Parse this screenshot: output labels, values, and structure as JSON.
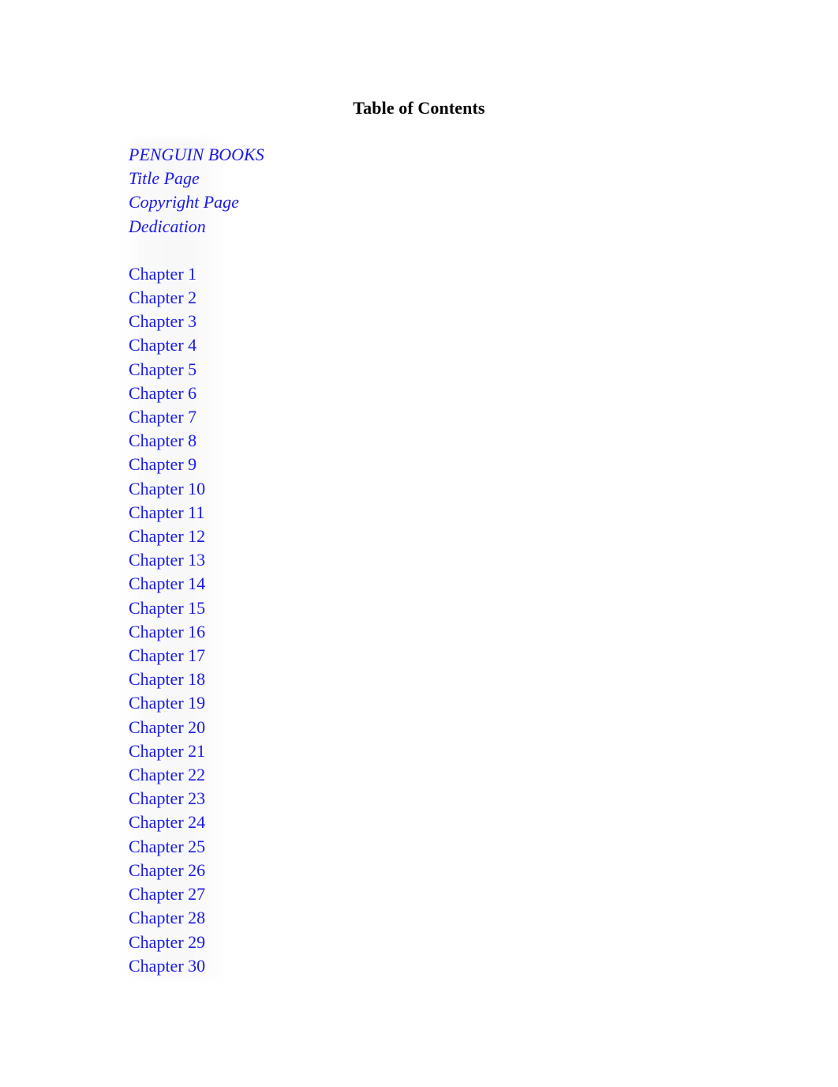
{
  "document": {
    "title": "Table of Contents",
    "text_color": "#000000",
    "link_color": "#1a1ae0",
    "background_color": "#ffffff"
  },
  "toc": {
    "front_matter": [
      {
        "label": "PENGUIN BOOKS"
      },
      {
        "label": "Title Page"
      },
      {
        "label": "Copyright Page"
      },
      {
        "label": "Dedication"
      }
    ],
    "chapters": [
      {
        "label": "Chapter 1"
      },
      {
        "label": "Chapter 2"
      },
      {
        "label": "Chapter 3"
      },
      {
        "label": "Chapter 4"
      },
      {
        "label": "Chapter 5"
      },
      {
        "label": "Chapter 6"
      },
      {
        "label": "Chapter 7"
      },
      {
        "label": "Chapter 8"
      },
      {
        "label": "Chapter 9"
      },
      {
        "label": "Chapter 10"
      },
      {
        "label": "Chapter 11"
      },
      {
        "label": "Chapter 12"
      },
      {
        "label": "Chapter 13"
      },
      {
        "label": "Chapter 14"
      },
      {
        "label": "Chapter 15"
      },
      {
        "label": "Chapter 16"
      },
      {
        "label": "Chapter 17"
      },
      {
        "label": "Chapter 18"
      },
      {
        "label": "Chapter 19"
      },
      {
        "label": "Chapter 20"
      },
      {
        "label": "Chapter 21"
      },
      {
        "label": "Chapter 22"
      },
      {
        "label": "Chapter 23"
      },
      {
        "label": "Chapter 24"
      },
      {
        "label": "Chapter 25"
      },
      {
        "label": "Chapter 26"
      },
      {
        "label": "Chapter 27"
      },
      {
        "label": "Chapter 28"
      },
      {
        "label": "Chapter 29"
      },
      {
        "label": "Chapter 30"
      }
    ]
  }
}
